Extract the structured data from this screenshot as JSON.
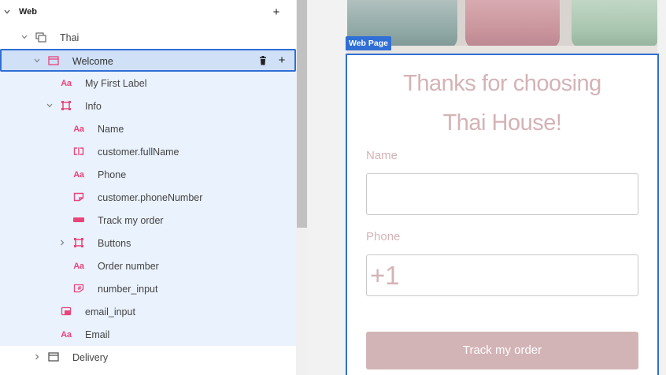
{
  "tree": {
    "root_label": "Web",
    "items": [
      {
        "label": "Thai"
      },
      {
        "label": "Welcome"
      },
      {
        "label": "My First Label"
      },
      {
        "label": "Info"
      },
      {
        "label": "Name"
      },
      {
        "label": "customer.fullName"
      },
      {
        "label": "Phone"
      },
      {
        "label": "customer.phoneNumber"
      },
      {
        "label": "Track my order"
      },
      {
        "label": "Buttons"
      },
      {
        "label": "Order number"
      },
      {
        "label": "number_input"
      },
      {
        "label": "email_input"
      },
      {
        "label": "Email"
      },
      {
        "label": "Delivery"
      }
    ],
    "icons": {
      "text": "Aa",
      "add": "+",
      "chevron_down": "⌄",
      "chevron_right": "›"
    }
  },
  "canvas": {
    "page_tag": "Web Page",
    "headline_line1": "Thanks for choosing",
    "headline_line2": "Thai House!",
    "name_label": "Name",
    "name_value": "",
    "phone_label": "Phone",
    "phone_value": "+1",
    "track_button": "Track my order"
  },
  "colors": {
    "accent": "#2f6fd6",
    "selection_bg": "#cfe0f7",
    "selection_zone": "#eaf2fd",
    "icon_pink": "#e9457a",
    "brand_rose": "#d4b3b6"
  }
}
